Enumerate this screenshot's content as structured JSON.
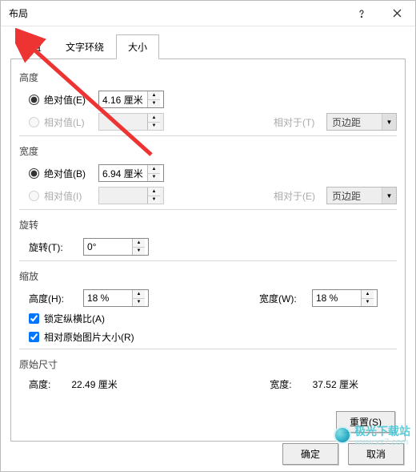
{
  "window": {
    "title": "布局"
  },
  "tabs": {
    "position": "位置",
    "wrap": "文字环绕",
    "size": "大小"
  },
  "height": {
    "section": "高度",
    "absolute_label": "绝对值(E)",
    "absolute_value": "4.16 厘米",
    "relative_label": "相对值(L)",
    "relative_value": "",
    "relative_to_label": "相对于(T)",
    "relative_to_value": "页边距"
  },
  "width": {
    "section": "宽度",
    "absolute_label": "绝对值(B)",
    "absolute_value": "6.94 厘米",
    "relative_label": "相对值(I)",
    "relative_value": "",
    "relative_to_label": "相对于(E)",
    "relative_to_value": "页边距"
  },
  "rotation": {
    "section": "旋转",
    "label": "旋转(T):",
    "value": "0°"
  },
  "scale": {
    "section": "缩放",
    "height_label": "高度(H):",
    "height_value": "18 %",
    "width_label": "宽度(W):",
    "width_value": "18 %",
    "lock_aspect": "锁定纵横比(A)",
    "relative_original": "相对原始图片大小(R)"
  },
  "original": {
    "section": "原始尺寸",
    "height_label": "高度:",
    "height_value": "22.49 厘米",
    "width_label": "宽度:",
    "width_value": "37.52 厘米",
    "reset": "重置(S)"
  },
  "footer": {
    "ok": "确定",
    "cancel": "取消"
  },
  "watermark": {
    "line1": "极光下载站",
    "line2": "www.xz7.com"
  }
}
